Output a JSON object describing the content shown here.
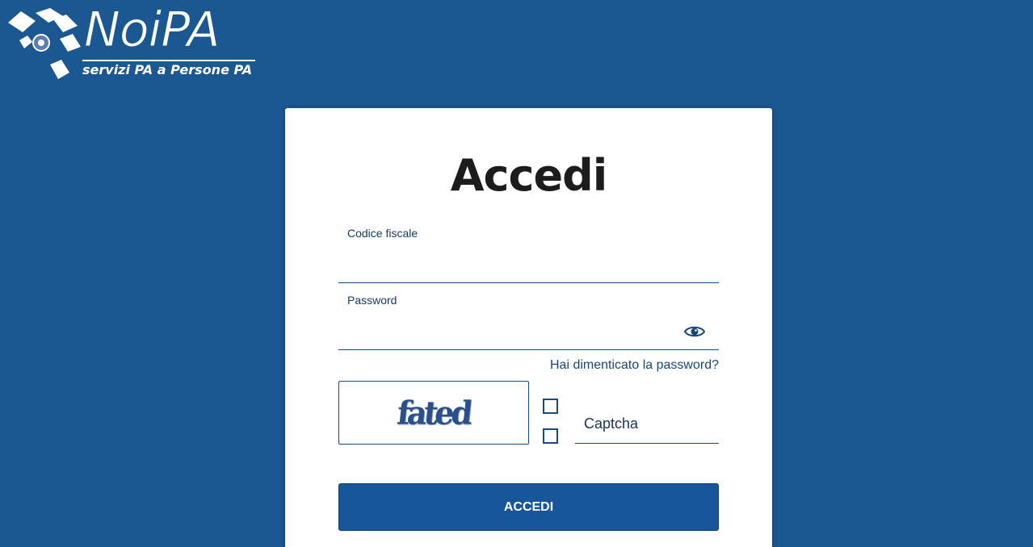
{
  "logo": {
    "name": "NoiPA",
    "tagline": "servizi PA a Persone PA"
  },
  "login": {
    "title": "Accedi",
    "fiscal_code_label": "Codice fiscale",
    "fiscal_code_value": "",
    "password_label": "Password",
    "password_value": "",
    "show_password_icon": "eye-icon",
    "forgot_password_link": "Hai dimenticato la password?",
    "captcha_image_text": "fated",
    "captcha_placeholder": "Captcha",
    "submit_label": "ACCEDI"
  },
  "colors": {
    "background": "#1b5791",
    "primary": "#17569b",
    "card": "#ffffff",
    "label": "#173a63"
  }
}
